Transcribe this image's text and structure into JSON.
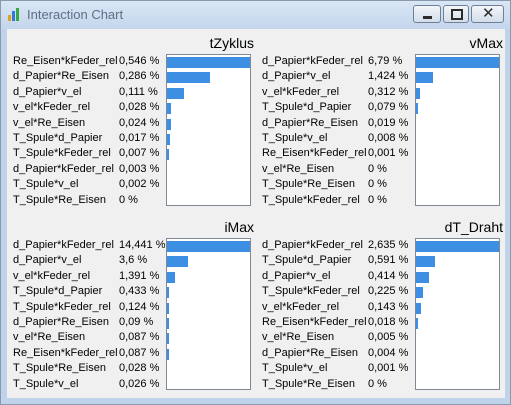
{
  "window": {
    "title": "Interaction Chart"
  },
  "colors": {
    "bar": "#3d8fe4",
    "window_frame": "#bfd3ea",
    "client": "#f0f0f0"
  },
  "panels": [
    {
      "title": "tZyklus",
      "rows": [
        {
          "label": "Re_Eisen*kFeder_rel",
          "value": "0,546 %",
          "pct": 0.546
        },
        {
          "label": "d_Papier*Re_Eisen",
          "value": "0,286 %",
          "pct": 0.286
        },
        {
          "label": "d_Papier*v_el",
          "value": "0,111 %",
          "pct": 0.111
        },
        {
          "label": "v_el*kFeder_rel",
          "value": "0,028 %",
          "pct": 0.028
        },
        {
          "label": "v_el*Re_Eisen",
          "value": "0,024 %",
          "pct": 0.024
        },
        {
          "label": "T_Spule*d_Papier",
          "value": "0,017 %",
          "pct": 0.017
        },
        {
          "label": "T_Spule*kFeder_rel",
          "value": "0,007 %",
          "pct": 0.007
        },
        {
          "label": "d_Papier*kFeder_rel",
          "value": "0,003 %",
          "pct": 0.003
        },
        {
          "label": "T_Spule*v_el",
          "value": "0,002 %",
          "pct": 0.002
        },
        {
          "label": "T_Spule*Re_Eisen",
          "value": "0 %",
          "pct": 0
        }
      ]
    },
    {
      "title": "vMax",
      "rows": [
        {
          "label": "d_Papier*kFeder_rel",
          "value": "6,79 %",
          "pct": 6.79
        },
        {
          "label": "d_Papier*v_el",
          "value": "1,424 %",
          "pct": 1.424
        },
        {
          "label": "v_el*kFeder_rel",
          "value": "0,312 %",
          "pct": 0.312
        },
        {
          "label": "T_Spule*d_Papier",
          "value": "0,079 %",
          "pct": 0.079
        },
        {
          "label": "d_Papier*Re_Eisen",
          "value": "0,019 %",
          "pct": 0.019
        },
        {
          "label": "T_Spule*v_el",
          "value": "0,008 %",
          "pct": 0.008
        },
        {
          "label": "Re_Eisen*kFeder_rel",
          "value": "0,001 %",
          "pct": 0.001
        },
        {
          "label": "v_el*Re_Eisen",
          "value": "0 %",
          "pct": 0
        },
        {
          "label": "T_Spule*Re_Eisen",
          "value": "0 %",
          "pct": 0
        },
        {
          "label": "T_Spule*kFeder_rel",
          "value": "0 %",
          "pct": 0
        }
      ]
    },
    {
      "title": "iMax",
      "rows": [
        {
          "label": "d_Papier*kFeder_rel",
          "value": "14,441 %",
          "pct": 14.441
        },
        {
          "label": "d_Papier*v_el",
          "value": "3,6 %",
          "pct": 3.6
        },
        {
          "label": "v_el*kFeder_rel",
          "value": "1,391 %",
          "pct": 1.391
        },
        {
          "label": "T_Spule*d_Papier",
          "value": "0,433 %",
          "pct": 0.433
        },
        {
          "label": "T_Spule*kFeder_rel",
          "value": "0,124 %",
          "pct": 0.124
        },
        {
          "label": "d_Papier*Re_Eisen",
          "value": "0,09 %",
          "pct": 0.09
        },
        {
          "label": "v_el*Re_Eisen",
          "value": "0,087 %",
          "pct": 0.087
        },
        {
          "label": "Re_Eisen*kFeder_rel",
          "value": "0,087 %",
          "pct": 0.087
        },
        {
          "label": "T_Spule*Re_Eisen",
          "value": "0,028 %",
          "pct": 0.028
        },
        {
          "label": "T_Spule*v_el",
          "value": "0,026 %",
          "pct": 0.026
        }
      ]
    },
    {
      "title": "dT_Draht",
      "rows": [
        {
          "label": "d_Papier*kFeder_rel",
          "value": "2,635 %",
          "pct": 2.635
        },
        {
          "label": "T_Spule*d_Papier",
          "value": "0,591 %",
          "pct": 0.591
        },
        {
          "label": "d_Papier*v_el",
          "value": "0,414 %",
          "pct": 0.414
        },
        {
          "label": "T_Spule*kFeder_rel",
          "value": "0,225 %",
          "pct": 0.225
        },
        {
          "label": "v_el*kFeder_rel",
          "value": "0,143 %",
          "pct": 0.143
        },
        {
          "label": "Re_Eisen*kFeder_rel",
          "value": "0,018 %",
          "pct": 0.018
        },
        {
          "label": "v_el*Re_Eisen",
          "value": "0,005 %",
          "pct": 0.005
        },
        {
          "label": "d_Papier*Re_Eisen",
          "value": "0,004 %",
          "pct": 0.004
        },
        {
          "label": "T_Spule*v_el",
          "value": "0,001 %",
          "pct": 0.001
        },
        {
          "label": "T_Spule*Re_Eisen",
          "value": "0 %",
          "pct": 0
        }
      ]
    }
  ]
}
